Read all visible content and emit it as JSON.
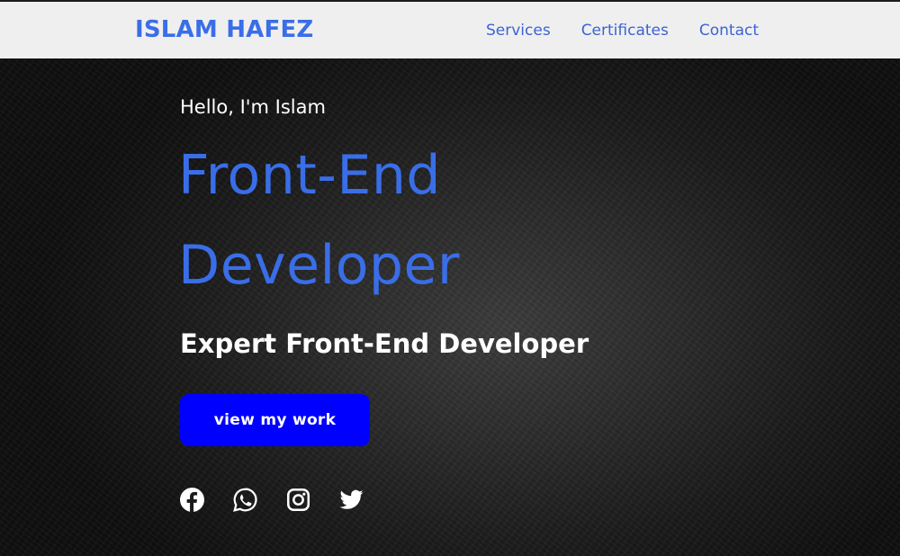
{
  "header": {
    "brand": "ISLAM HAFEZ",
    "nav": [
      {
        "label": "Services"
      },
      {
        "label": "Certificates"
      },
      {
        "label": "Contact"
      }
    ]
  },
  "hero": {
    "greeting": "Hello, I'm Islam",
    "title_line1": "Front-End",
    "title_line2": "Developer",
    "subtitle": "Expert Front-End Developer",
    "cta_label": "view my work"
  },
  "socials": [
    {
      "icon": "facebook-icon"
    },
    {
      "icon": "whatsapp-icon"
    },
    {
      "icon": "instagram-icon"
    },
    {
      "icon": "twitter-icon"
    }
  ],
  "colors": {
    "accent": "#3a6ee8",
    "nav_link": "#3c63d4",
    "cta_bg": "#0000ff",
    "header_bg": "#efefef",
    "hero_bg": "#1a1a1a"
  }
}
